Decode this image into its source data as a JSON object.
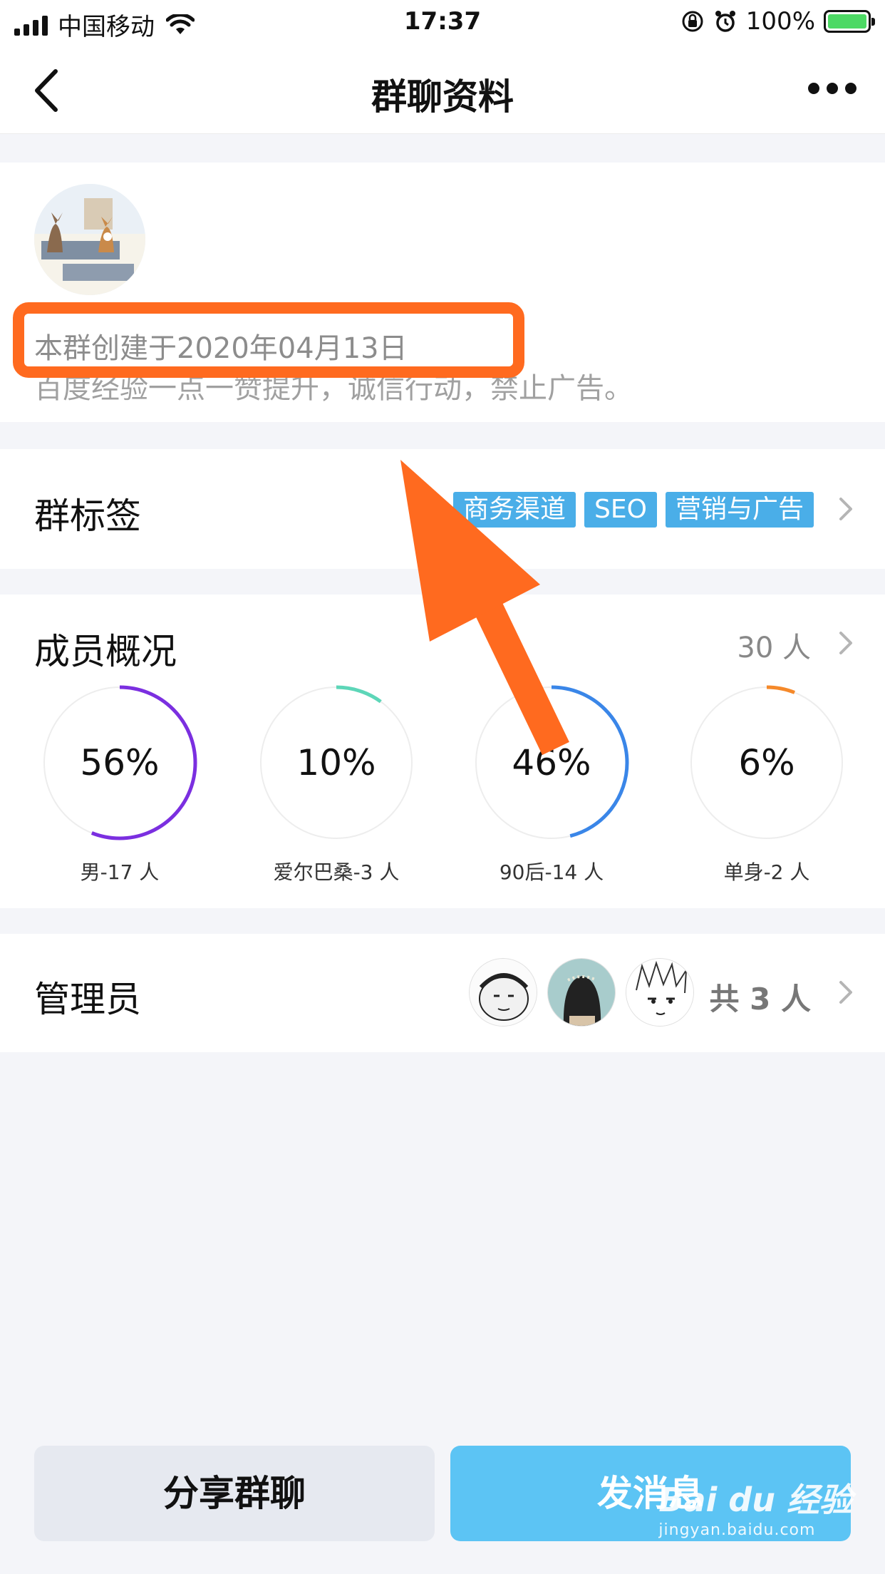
{
  "status_bar": {
    "carrier": "中国移动",
    "time": "17:37",
    "battery": "100%"
  },
  "nav": {
    "title": "群聊资料",
    "back_icon": "chevron-left-icon",
    "more_icon": "more-dots-icon"
  },
  "info": {
    "created": "本群创建于2020年04月13日",
    "description": "百度经验一点一赞提升，诚信行动，禁止广告。"
  },
  "tags": {
    "label": "群标签",
    "items": [
      "商务渠道",
      "SEO",
      "营销与广告"
    ]
  },
  "members": {
    "label": "成员概况",
    "count": "30 人",
    "stats": [
      {
        "percent": "56%",
        "value": 0.56,
        "label": "男-17 人",
        "color": "#7b2fe0"
      },
      {
        "percent": "10%",
        "value": 0.1,
        "label": "爱尔巴桑-3 人",
        "color": "#5dd6b8"
      },
      {
        "percent": "46%",
        "value": 0.46,
        "label": "90后-14 人",
        "color": "#3a86e8"
      },
      {
        "percent": "6%",
        "value": 0.06,
        "label": "单身-2 人",
        "color": "#f5892a"
      }
    ]
  },
  "admins": {
    "label": "管理员",
    "total": "共 3 人"
  },
  "buttons": {
    "share": "分享群聊",
    "send": "发消息"
  },
  "watermark": {
    "brand": "Bai du 经验",
    "url": "jingyan.baidu.com"
  },
  "colors": {
    "accent": "#5cc4f4",
    "tag": "#4aaee8",
    "highlight": "#ff6a1f"
  }
}
